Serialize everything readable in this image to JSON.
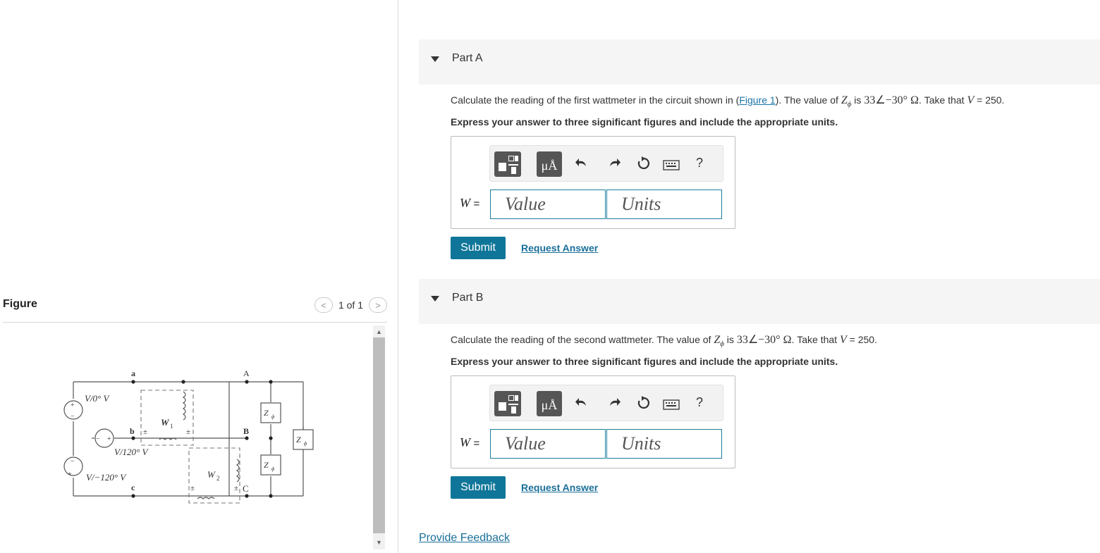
{
  "figure": {
    "title": "Figure",
    "pager": {
      "prev": "<",
      "label": "1 of 1",
      "next": ">"
    },
    "circuit": {
      "nodes": {
        "a": "a",
        "b": "b",
        "c": "c",
        "A": "A",
        "B": "B",
        "C": "C"
      },
      "sources": [
        "V/0° V",
        "V/120° V",
        "V/−120° V"
      ],
      "wattmeters": [
        "W",
        "W"
      ],
      "wattmeter_subs": [
        "1",
        "2"
      ],
      "impedance": "Z",
      "impedance_sub": "ϕ",
      "plus": "+",
      "minus": "−",
      "pm": "±"
    }
  },
  "parts": [
    {
      "title": "Part A",
      "question": {
        "pre": "Calculate the reading of the first wattmeter in the circuit shown in (",
        "link": "Figure 1",
        "mid": "). The value of ",
        "z": "Z",
        "zsub": "ϕ",
        "is": " is ",
        "zval": "33∠−30° Ω",
        "take": ". Take that ",
        "v": "V",
        "vval": " = 250."
      },
      "instruction": "Express your answer to three significant figures and include the appropriate units.",
      "var_label": "W",
      "eq": "=",
      "value_placeholder": "Value",
      "units_placeholder": "Units",
      "submit": "Submit",
      "request": "Request Answer"
    },
    {
      "title": "Part B",
      "question": {
        "pre": "Calculate the reading of the second wattmeter. The value of ",
        "z": "Z",
        "zsub": "ϕ",
        "is": " is ",
        "zval": "33∠−30° Ω",
        "take": ". Take that ",
        "v": "V",
        "vval": " = 250."
      },
      "instruction": "Express your answer to three significant figures and include the appropriate units.",
      "var_label": "W",
      "eq": "=",
      "value_placeholder": "Value",
      "units_placeholder": "Units",
      "submit": "Submit",
      "request": "Request Answer"
    }
  ],
  "toolbar": {
    "units_glyph": "μÅ",
    "undo_icon": "undo-icon",
    "redo_icon": "redo-icon",
    "reset_icon": "reset-icon",
    "keyboard_icon": "keyboard-icon",
    "help": "?"
  },
  "feedback": "Provide Feedback"
}
